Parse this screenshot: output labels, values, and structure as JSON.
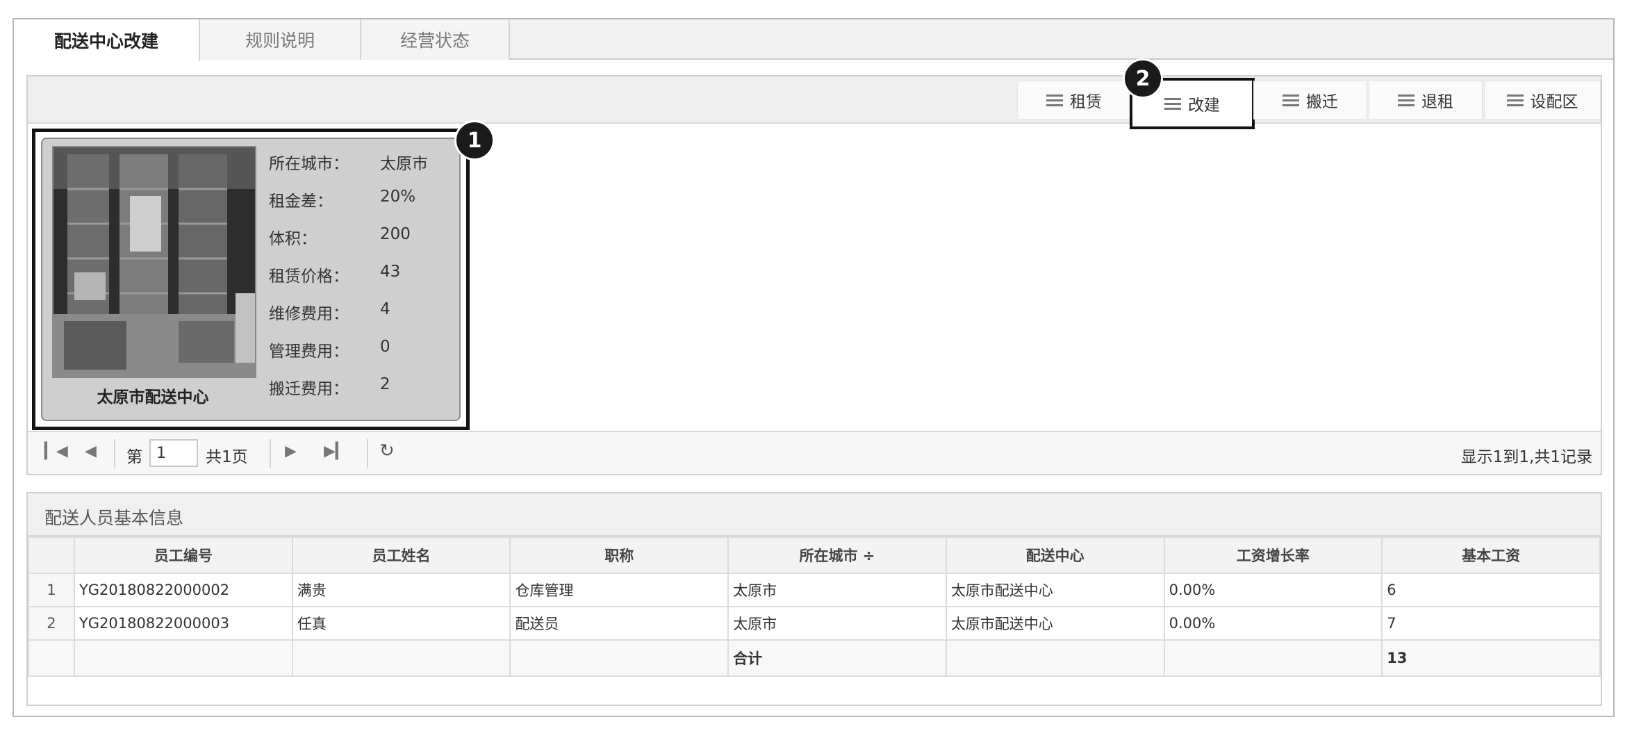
{
  "tabs": [
    {
      "label": "配送中心改建",
      "active": true
    },
    {
      "label": "规则说明",
      "active": false
    },
    {
      "label": "经营状态",
      "active": false
    }
  ],
  "toolbar": {
    "buttons": [
      {
        "label": "租赁",
        "icon": "list-icon"
      },
      {
        "label": "改建",
        "icon": "list-icon",
        "highlighted": true
      },
      {
        "label": "搬迁",
        "icon": "list-icon"
      },
      {
        "label": "退租",
        "icon": "list-icon"
      },
      {
        "label": "设配区",
        "icon": "list-icon"
      }
    ]
  },
  "callouts": {
    "one": "1",
    "two": "2"
  },
  "card": {
    "name": "太原市配送中心",
    "fields": [
      {
        "label": "所在城市：",
        "value": "太原市"
      },
      {
        "label": "租金差：",
        "value": "20%"
      },
      {
        "label": "体积：",
        "value": "200"
      },
      {
        "label": "租赁价格：",
        "value": "43"
      },
      {
        "label": "维修费用：",
        "value": "4"
      },
      {
        "label": "管理费用：",
        "value": "0"
      },
      {
        "label": "搬迁费用：",
        "value": "2"
      }
    ]
  },
  "pager": {
    "page_prefix": "第",
    "page_value": "1",
    "page_total": "共1页",
    "summary": "显示1到1,共1记录"
  },
  "staff_table": {
    "title": "配送人员基本信息",
    "columns": [
      "员工编号",
      "员工姓名",
      "职称",
      "所在城市 ÷",
      "配送中心",
      "工资增长率",
      "基本工资"
    ],
    "rows": [
      {
        "rn": "1",
        "cells": [
          "YG20180822000002",
          "满贵",
          "仓库管理",
          "太原市",
          "太原市配送中心",
          "0.00%",
          "6"
        ]
      },
      {
        "rn": "2",
        "cells": [
          "YG20180822000003",
          "任真",
          "配送员",
          "太原市",
          "太原市配送中心",
          "0.00%",
          "7"
        ]
      }
    ],
    "footer": {
      "label": "合计",
      "total": "13"
    }
  },
  "colors": {
    "highlight_border": "#111111",
    "card_bg": "#cfcfcf",
    "toolbar_bg": "#eeeeee"
  }
}
